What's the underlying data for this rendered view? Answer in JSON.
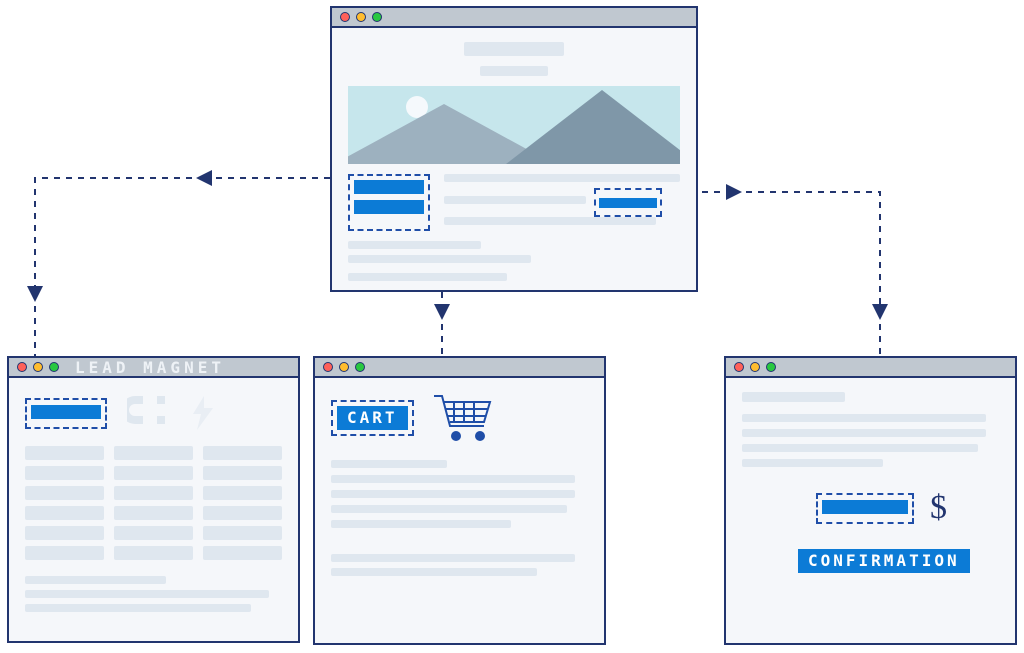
{
  "diagram": {
    "nodes": {
      "hero": {
        "title_bar": "",
        "cta_a": "",
        "cta_b": "",
        "inline_link": ""
      },
      "lead_magnet": {
        "title_bar": "LEAD MAGNET",
        "cta": ""
      },
      "cart": {
        "title_bar": "",
        "label": "CART"
      },
      "confirmation": {
        "title_bar": "",
        "cta": "",
        "currency": "$",
        "label": "CONFIRMATION"
      }
    },
    "edges": [
      {
        "from": "hero.cta_a",
        "to": "lead_magnet"
      },
      {
        "from": "hero.cta_b",
        "to": "cart"
      },
      {
        "from": "hero.inline_link",
        "to": "confirmation"
      },
      {
        "from": "confirmation",
        "to": "confirmation.cta"
      }
    ],
    "colors": {
      "outline": "#22356f",
      "accent": "#0c7bd6",
      "placeholder": "#dfe7ef",
      "titlebar": "#c0c8d0",
      "hero_sky": "#c6e6ec"
    }
  }
}
